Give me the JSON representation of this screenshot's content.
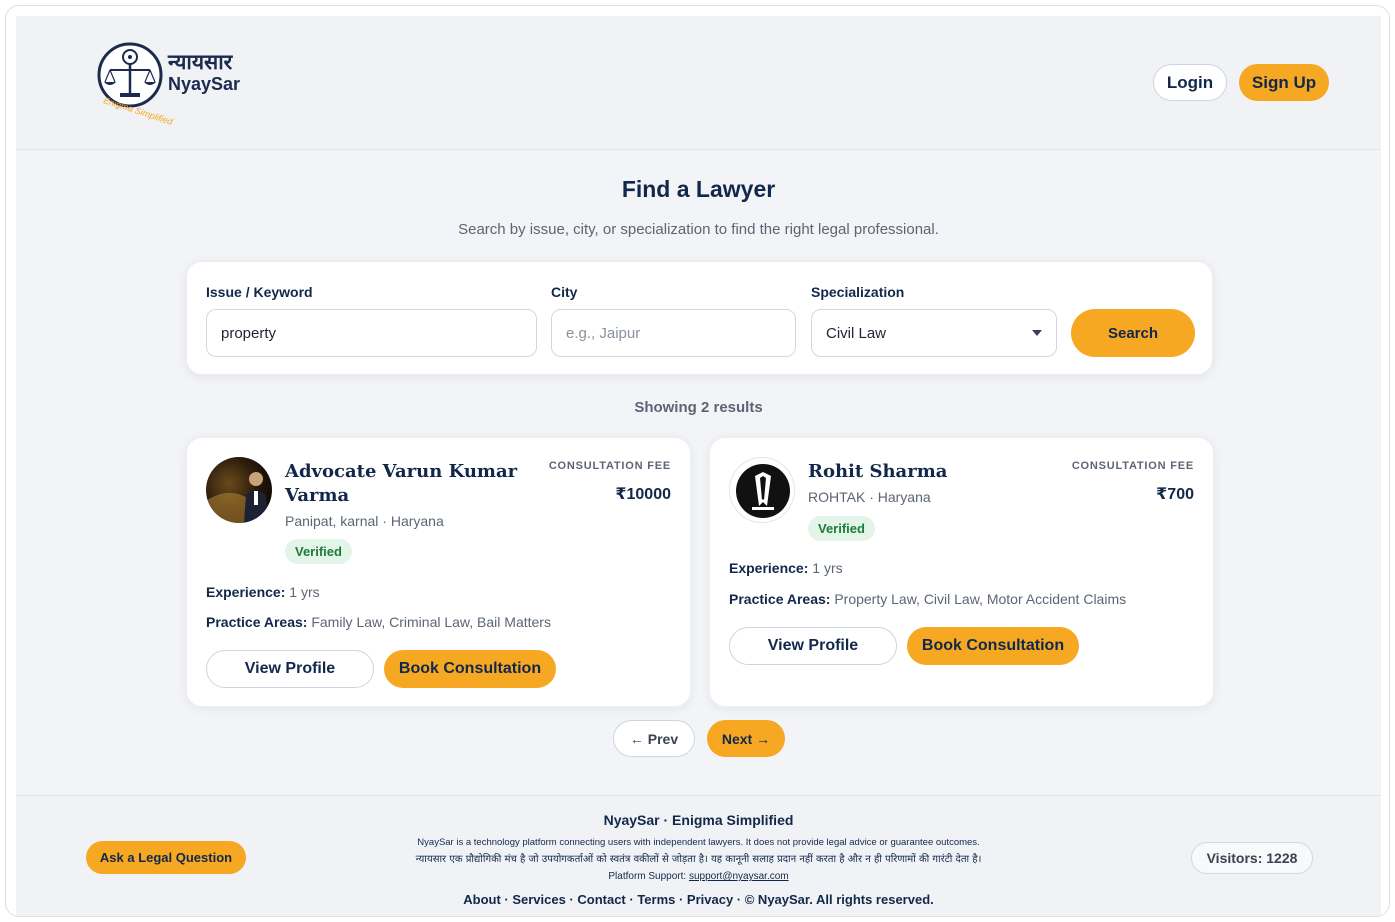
{
  "header": {
    "logo_hindi": "न्यायसार",
    "logo_english": "NyaySar",
    "logo_tagline": "Enigma Simplified",
    "login_label": "Login",
    "signup_label": "Sign Up"
  },
  "main": {
    "title": "Find a Lawyer",
    "subtitle": "Search by issue, city, or specialization to find the right legal professional."
  },
  "search": {
    "issue_label": "Issue / Keyword",
    "issue_value": "property",
    "city_label": "City",
    "city_placeholder": "e.g., Jaipur",
    "specialization_label": "Specialization",
    "specialization_value": "Civil Law",
    "search_label": "Search"
  },
  "results": {
    "count_text": "Showing 2 results",
    "lawyers": [
      {
        "name": "Advocate Varun Kumar Varma",
        "location": "Panipat, karnal · Haryana",
        "badge": "Verified",
        "fee_label": "CONSULTATION FEE",
        "fee": "₹10000",
        "experience_label": "Experience:",
        "experience": "1 yrs",
        "practice_label": "Practice Areas:",
        "practice": "Family Law, Criminal Law, Bail Matters",
        "view_label": "View Profile",
        "book_label": "Book Consultation"
      },
      {
        "name": "Rohit Sharma",
        "location": "ROHTAK · Haryana",
        "badge": "Verified",
        "fee_label": "CONSULTATION FEE",
        "fee": "₹700",
        "experience_label": "Experience:",
        "experience": "1 yrs",
        "practice_label": "Practice Areas:",
        "practice": "Property Law, Civil Law, Motor Accident Claims",
        "view_label": "View Profile",
        "book_label": "Book Consultation"
      }
    ]
  },
  "pagination": {
    "prev_label": "← Prev",
    "next_label": "Next →"
  },
  "footer": {
    "brand": "NyaySar · Enigma Simplified",
    "disclaimer_en": "NyaySar is a technology platform connecting users with independent lawyers. It does not provide legal advice or guarantee outcomes.",
    "disclaimer_hi": "न्यायसार एक प्रौद्योगिकी मंच है जो उपयोगकर्ताओं को स्वतंत्र वकीलों से जोड़ता है। यह कानूनी सलाह प्रदान नहीं करता है और न ही परिणामों की गारंटी देता है।",
    "support_label": "Platform Support:",
    "support_email": "support@nyaysar.com",
    "links_text": "About · Services · Contact · Terms · Privacy · © NyaySar. All rights reserved.",
    "ask_label": "Ask a Legal Question",
    "visitors_text": "Visitors: 1228"
  },
  "colors": {
    "accent": "#f7a823",
    "navy": "#12284a",
    "verified_bg": "#e3f4e8",
    "verified_text": "#1f7a3a"
  }
}
